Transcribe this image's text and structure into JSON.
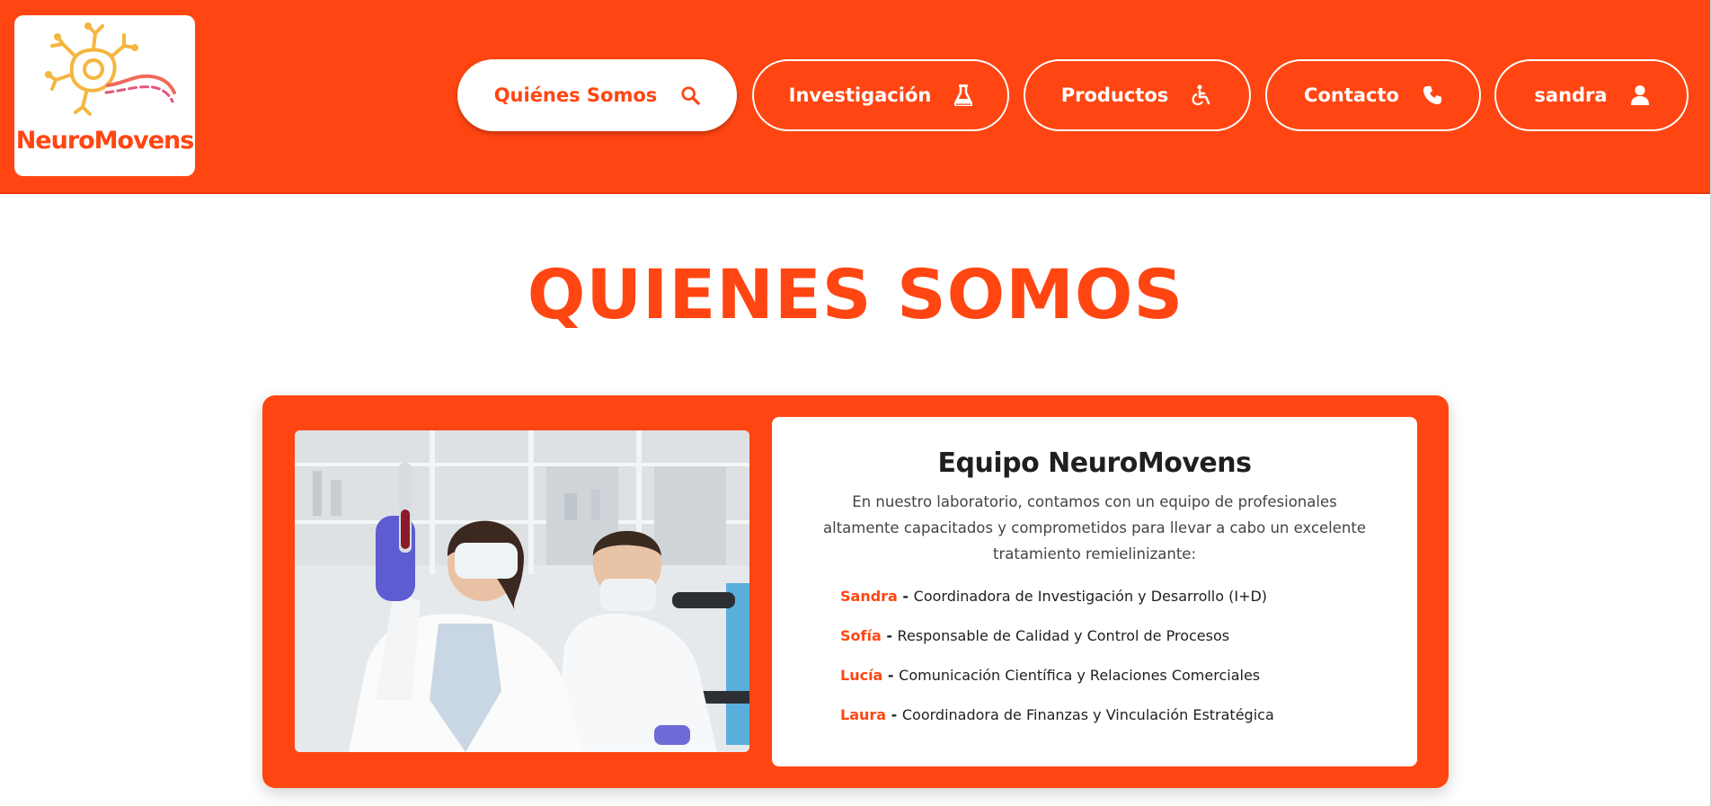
{
  "brand": {
    "name": "NeuroMovens",
    "accent_color": "#ff4612"
  },
  "nav": {
    "items": [
      {
        "label": "Quiénes Somos",
        "icon": "search-icon",
        "active": true
      },
      {
        "label": "Investigación",
        "icon": "flask-icon",
        "active": false
      },
      {
        "label": "Productos",
        "icon": "wheelchair-icon",
        "active": false
      },
      {
        "label": "Contacto",
        "icon": "phone-icon",
        "active": false
      },
      {
        "label": "sandra",
        "icon": "user-icon",
        "active": false
      }
    ]
  },
  "page": {
    "title": "QUIENES SOMOS"
  },
  "team": {
    "photo_icon": "lab-scientists-photo",
    "title": "Equipo NeuroMovens",
    "description": "En nuestro laboratorio, contamos con un equipo de profesionales altamente capacitados y comprometidos para llevar a cabo un excelente tratamiento remielinizante:",
    "separator": " - ",
    "members": [
      {
        "name": "Sandra",
        "role": "Coordinadora de Investigación y Desarrollo (I+D)"
      },
      {
        "name": "Sofía",
        "role": "Responsable de Calidad y Control de Procesos"
      },
      {
        "name": "Lucía",
        "role": "Comunicación Científica y Relaciones Comerciales"
      },
      {
        "name": "Laura",
        "role": "Coordinadora de Finanzas y Vinculación Estratégica"
      }
    ]
  }
}
